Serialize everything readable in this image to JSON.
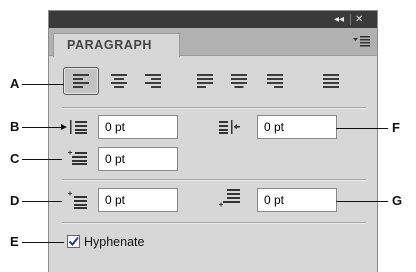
{
  "panel": {
    "title": "PARAGRAPH",
    "collapse_glyph": "◂◂",
    "close_glyph": "✕",
    "menu_icon": "panel-menu-icon"
  },
  "alignment_buttons": [
    {
      "name": "align-left",
      "selected": true
    },
    {
      "name": "align-center",
      "selected": false
    },
    {
      "name": "align-right",
      "selected": false
    },
    {
      "name": "justify-last-left",
      "selected": false
    },
    {
      "name": "justify-last-center",
      "selected": false
    },
    {
      "name": "justify-last-right",
      "selected": false
    },
    {
      "name": "justify-all",
      "selected": false
    }
  ],
  "fields": {
    "left_indent": "0 pt",
    "right_indent": "0 pt",
    "first_line_indent": "0 pt",
    "space_before": "0 pt",
    "space_after": "0 pt"
  },
  "hyphenate": {
    "label": "Hyphenate",
    "checked": true
  },
  "callouts": {
    "a": "A",
    "b": "B",
    "c": "C",
    "d": "D",
    "e": "E",
    "f": "F",
    "g": "G"
  },
  "colors": {
    "panel_bg": "#d7d7d7",
    "titlebar": "#3a3a3a",
    "tab_strip": "#b1b1b1",
    "checkmark": "#1a3fa8"
  }
}
